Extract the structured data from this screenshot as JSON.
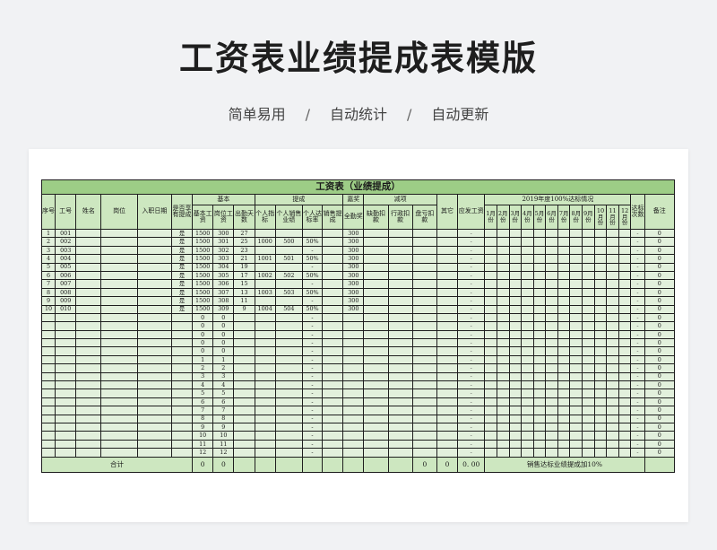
{
  "page": {
    "title": "工资表业绩提成表模版",
    "features": [
      "简单易用",
      "自动统计",
      "自动更新"
    ],
    "separator": "/"
  },
  "sheet": {
    "title": "工资表（业绩提成）",
    "headers": {
      "seq": "序号",
      "emp_no": "工号",
      "name": "姓名",
      "position": "岗位",
      "hire_date": "入职日期",
      "commission_flag": "是否享有提成",
      "group_basic": "基本",
      "basic_salary": "基本工资",
      "post_salary": "岗位工资",
      "attendance_days": "出勤天数",
      "group_commission": "提成",
      "personal_target": "个人指标",
      "personal_sales": "个人销售业绩",
      "target_rate": "个人达标率",
      "sales_commission": "销售提成",
      "group_bonus": "嘉奖",
      "full_attendance": "全勤奖",
      "group_deduction": "减项",
      "absence_deduction": "缺勤扣款",
      "admin_deduction": "行政扣款",
      "inventory_deduction": "盘亏扣款",
      "other": "其它",
      "payable": "应发工资",
      "monthly_group": "2019年度100%达标情况",
      "months": [
        "1月份",
        "2月份",
        "3月份",
        "4月份",
        "5月份",
        "6月份",
        "7月份",
        "8月份",
        "9月份",
        "10月份",
        "11月份",
        "12月份"
      ],
      "target_count": "达标次数",
      "remarks": "备注"
    },
    "rows": [
      {
        "seq": "1",
        "emp_no": "001",
        "flag": "是",
        "basic": "1500",
        "post": "300",
        "days": "27",
        "target": "",
        "sales": "",
        "rate": "",
        "full": "300",
        "payable": "-",
        "count": "-",
        "remark": "0"
      },
      {
        "seq": "2",
        "emp_no": "002",
        "flag": "是",
        "basic": "1500",
        "post": "301",
        "days": "25",
        "target": "1000",
        "sales": "500",
        "rate": "50%",
        "full": "300",
        "payable": "-",
        "count": "-",
        "remark": "0"
      },
      {
        "seq": "3",
        "emp_no": "003",
        "flag": "是",
        "basic": "1500",
        "post": "302",
        "days": "23",
        "target": "",
        "sales": "",
        "rate": "-",
        "full": "300",
        "payable": "-",
        "count": "-",
        "remark": "0"
      },
      {
        "seq": "4",
        "emp_no": "004",
        "flag": "是",
        "basic": "1500",
        "post": "303",
        "days": "21",
        "target": "1001",
        "sales": "501",
        "rate": "50%",
        "full": "300",
        "payable": "-",
        "count": "-",
        "remark": "0"
      },
      {
        "seq": "5",
        "emp_no": "005",
        "flag": "是",
        "basic": "1500",
        "post": "304",
        "days": "19",
        "target": "",
        "sales": "",
        "rate": "-",
        "full": "300",
        "payable": "-",
        "count": "-",
        "remark": "0"
      },
      {
        "seq": "6",
        "emp_no": "006",
        "flag": "是",
        "basic": "1500",
        "post": "305",
        "days": "17",
        "target": "1002",
        "sales": "502",
        "rate": "50%",
        "full": "300",
        "payable": "-",
        "count": "-",
        "remark": "0"
      },
      {
        "seq": "7",
        "emp_no": "007",
        "flag": "是",
        "basic": "1500",
        "post": "306",
        "days": "15",
        "target": "",
        "sales": "",
        "rate": "-",
        "full": "300",
        "payable": "-",
        "count": "-",
        "remark": "0"
      },
      {
        "seq": "8",
        "emp_no": "008",
        "flag": "是",
        "basic": "1500",
        "post": "307",
        "days": "13",
        "target": "1003",
        "sales": "503",
        "rate": "50%",
        "full": "300",
        "payable": "-",
        "count": "-",
        "remark": "0"
      },
      {
        "seq": "9",
        "emp_no": "009",
        "flag": "是",
        "basic": "1500",
        "post": "308",
        "days": "11",
        "target": "",
        "sales": "",
        "rate": "-",
        "full": "300",
        "payable": "-",
        "count": "-",
        "remark": "0"
      },
      {
        "seq": "10",
        "emp_no": "010",
        "flag": "是",
        "basic": "1500",
        "post": "309",
        "days": "9",
        "target": "1004",
        "sales": "504",
        "rate": "50%",
        "full": "300",
        "payable": "-",
        "count": "-",
        "remark": "0"
      },
      {
        "seq": "",
        "emp_no": "",
        "flag": "",
        "basic": "0",
        "post": "0",
        "days": "",
        "target": "",
        "sales": "",
        "rate": "-",
        "full": "",
        "payable": "-",
        "count": "-",
        "remark": "0"
      },
      {
        "seq": "",
        "emp_no": "",
        "flag": "",
        "basic": "0",
        "post": "0",
        "days": "",
        "target": "",
        "sales": "",
        "rate": "-",
        "full": "",
        "payable": "-",
        "count": "-",
        "remark": "0"
      },
      {
        "seq": "",
        "emp_no": "",
        "flag": "",
        "basic": "0",
        "post": "0",
        "days": "",
        "target": "",
        "sales": "",
        "rate": "-",
        "full": "",
        "payable": "-",
        "count": "-",
        "remark": "0"
      },
      {
        "seq": "",
        "emp_no": "",
        "flag": "",
        "basic": "0",
        "post": "0",
        "days": "",
        "target": "",
        "sales": "",
        "rate": "-",
        "full": "",
        "payable": "-",
        "count": "-",
        "remark": "0"
      },
      {
        "seq": "",
        "emp_no": "",
        "flag": "",
        "basic": "0",
        "post": "0",
        "days": "",
        "target": "",
        "sales": "",
        "rate": "-",
        "full": "",
        "payable": "-",
        "count": "-",
        "remark": "0"
      },
      {
        "seq": "",
        "emp_no": "",
        "flag": "",
        "basic": "1",
        "post": "1",
        "days": "",
        "target": "",
        "sales": "",
        "rate": "-",
        "full": "",
        "payable": "-",
        "count": "-",
        "remark": "0"
      },
      {
        "seq": "",
        "emp_no": "",
        "flag": "",
        "basic": "2",
        "post": "2",
        "days": "",
        "target": "",
        "sales": "",
        "rate": "-",
        "full": "",
        "payable": "-",
        "count": "-",
        "remark": "0"
      },
      {
        "seq": "",
        "emp_no": "",
        "flag": "",
        "basic": "3",
        "post": "3",
        "days": "",
        "target": "",
        "sales": "",
        "rate": "-",
        "full": "",
        "payable": "-",
        "count": "-",
        "remark": "0"
      },
      {
        "seq": "",
        "emp_no": "",
        "flag": "",
        "basic": "4",
        "post": "4",
        "days": "",
        "target": "",
        "sales": "",
        "rate": "-",
        "full": "",
        "payable": "-",
        "count": "-",
        "remark": "0"
      },
      {
        "seq": "",
        "emp_no": "",
        "flag": "",
        "basic": "5",
        "post": "5",
        "days": "",
        "target": "",
        "sales": "",
        "rate": "-",
        "full": "",
        "payable": "-",
        "count": "-",
        "remark": "0"
      },
      {
        "seq": "",
        "emp_no": "",
        "flag": "",
        "basic": "6",
        "post": "6",
        "days": "",
        "target": "",
        "sales": "",
        "rate": "-",
        "full": "",
        "payable": "-",
        "count": "-",
        "remark": "0"
      },
      {
        "seq": "",
        "emp_no": "",
        "flag": "",
        "basic": "7",
        "post": "7",
        "days": "",
        "target": "",
        "sales": "",
        "rate": "-",
        "full": "",
        "payable": "-",
        "count": "-",
        "remark": "0"
      },
      {
        "seq": "",
        "emp_no": "",
        "flag": "",
        "basic": "8",
        "post": "8",
        "days": "",
        "target": "",
        "sales": "",
        "rate": "-",
        "full": "",
        "payable": "-",
        "count": "-",
        "remark": "0"
      },
      {
        "seq": "",
        "emp_no": "",
        "flag": "",
        "basic": "9",
        "post": "9",
        "days": "",
        "target": "",
        "sales": "",
        "rate": "-",
        "full": "",
        "payable": "-",
        "count": "-",
        "remark": "0"
      },
      {
        "seq": "",
        "emp_no": "",
        "flag": "",
        "basic": "10",
        "post": "10",
        "days": "",
        "target": "",
        "sales": "",
        "rate": "-",
        "full": "",
        "payable": "-",
        "count": "-",
        "remark": "0"
      },
      {
        "seq": "",
        "emp_no": "",
        "flag": "",
        "basic": "11",
        "post": "11",
        "days": "",
        "target": "",
        "sales": "",
        "rate": "-",
        "full": "",
        "payable": "-",
        "count": "-",
        "remark": "0"
      },
      {
        "seq": "",
        "emp_no": "",
        "flag": "",
        "basic": "12",
        "post": "12",
        "days": "",
        "target": "",
        "sales": "",
        "rate": "-",
        "full": "",
        "payable": "-",
        "count": "-",
        "remark": "0"
      }
    ],
    "totals": {
      "label": "合计",
      "basic": "0",
      "post": "0",
      "inventory": "0",
      "other": "0",
      "payable": "0. 00",
      "note": "销售达标业绩提成加10%"
    }
  }
}
